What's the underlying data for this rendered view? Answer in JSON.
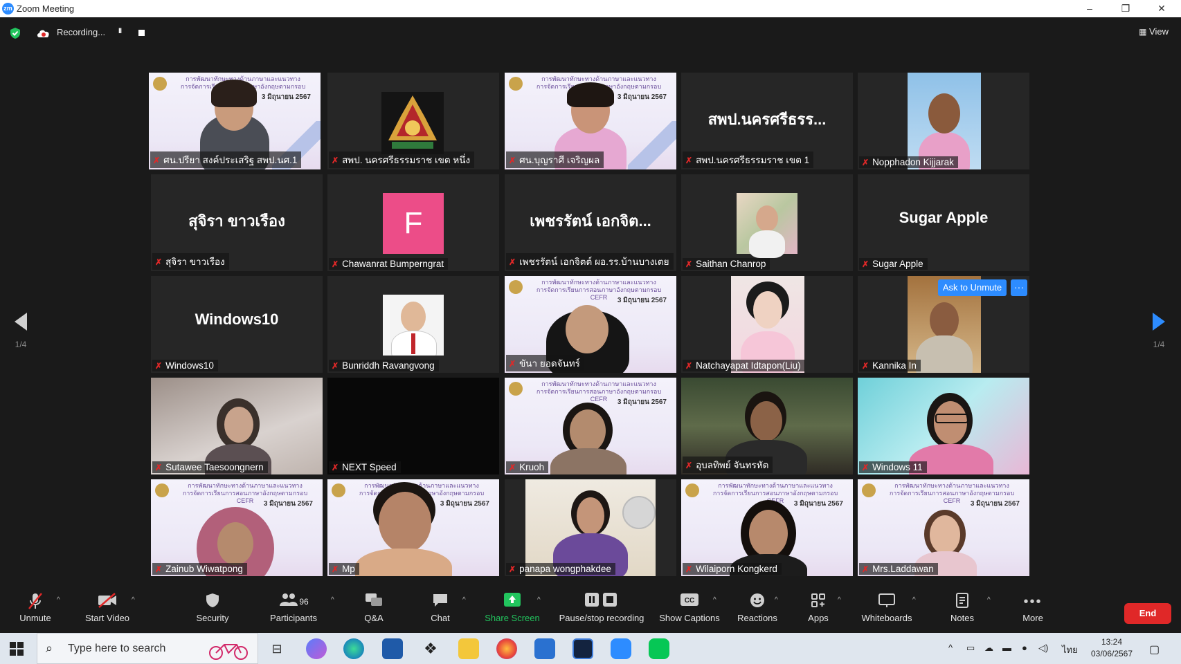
{
  "window": {
    "title": "Zoom Meeting",
    "minimize": "–",
    "maximize": "❐",
    "close": "✕"
  },
  "topbar": {
    "recording_label": "Recording...",
    "pause": "II",
    "view_label": "View"
  },
  "pagination": {
    "left": "1/4",
    "right": "1/4"
  },
  "ask_to_unmute": {
    "label": "Ask to Unmute",
    "more": "···"
  },
  "participants": [
    {
      "name": "ศน.ปรียา สงค์ประเสริฐ สพป.นศ.1",
      "kind": "video"
    },
    {
      "name": "สพป. นครศรีธรรมราช เขต หนึ่ง",
      "kind": "logo"
    },
    {
      "name": "ศน.บุญราศี เจริญผล",
      "kind": "video"
    },
    {
      "name": "สพป.นครศรีธรรมราช เขต 1",
      "kind": "text",
      "display": "สพป.นครศรีธรร..."
    },
    {
      "name": "Nopphadon  Kijjarak",
      "kind": "photo"
    },
    {
      "name": "สุจิรา ขาวเรือง",
      "kind": "text",
      "display": "สุจิรา ขาวเรือง"
    },
    {
      "name": "Chawanrat Bumperngrat",
      "kind": "avatar",
      "display": "F"
    },
    {
      "name": "เพชรรัตน์ เอกจิตต์ ผอ.รร.บ้านบางเตย",
      "kind": "text",
      "display": "เพชรรัตน์ เอกจิต..."
    },
    {
      "name": "Saithan Chanrop",
      "kind": "photo"
    },
    {
      "name": "Sugar Apple",
      "kind": "text",
      "display": "Sugar Apple"
    },
    {
      "name": "Windows10",
      "kind": "text",
      "display": "Windows10"
    },
    {
      "name": "Bunriddh Ravangvong",
      "kind": "photo"
    },
    {
      "name": "ขันา ยอดจันทร์",
      "kind": "video"
    },
    {
      "name": "Natchayapat Idtapon(Liu)",
      "kind": "photo"
    },
    {
      "name": "Kannika In",
      "kind": "photo"
    },
    {
      "name": "Sutawee Taesoongnern",
      "kind": "video"
    },
    {
      "name": "NEXT Speed",
      "kind": "dark"
    },
    {
      "name": "Kruoh",
      "kind": "video"
    },
    {
      "name": "อุบลทิพย์ จันทรหัต",
      "kind": "video"
    },
    {
      "name": "Windows 11",
      "kind": "video"
    },
    {
      "name": "Zainub Wiwatpong",
      "kind": "video"
    },
    {
      "name": "Mp",
      "kind": "video"
    },
    {
      "name": "panapa wongphakdee",
      "kind": "video"
    },
    {
      "name": "Wilaiporn Kongkerd",
      "kind": "video"
    },
    {
      "name": "Mrs.Laddawan",
      "kind": "video"
    }
  ],
  "slide_text": {
    "line1": "การพัฒนาทักษะทางด้านภาษาและแนวทาง",
    "line2": "การจัดการเรียนการสอนภาษาอังกฤษตามกรอบ CEFR",
    "date": "3 มิถุนายน 2567"
  },
  "toolbar": {
    "unmute": "Unmute",
    "start_video": "Start Video",
    "security": "Security",
    "participants": "Participants",
    "participant_count": "96",
    "qa": "Q&A",
    "chat": "Chat",
    "share_screen": "Share Screen",
    "pause_stop": "Pause/stop recording",
    "captions": "Show Captions",
    "reactions": "Reactions",
    "apps": "Apps",
    "whiteboards": "Whiteboards",
    "notes": "Notes",
    "more": "More",
    "end": "End"
  },
  "taskbar": {
    "search_placeholder": "Type here to search",
    "lang": "ไทย",
    "time": "13:24",
    "date": "03/06/2567"
  },
  "colors": {
    "accent": "#2d8cff",
    "end": "#e02828",
    "share": "#22c55e",
    "active_speaker": "#d6e56a"
  }
}
